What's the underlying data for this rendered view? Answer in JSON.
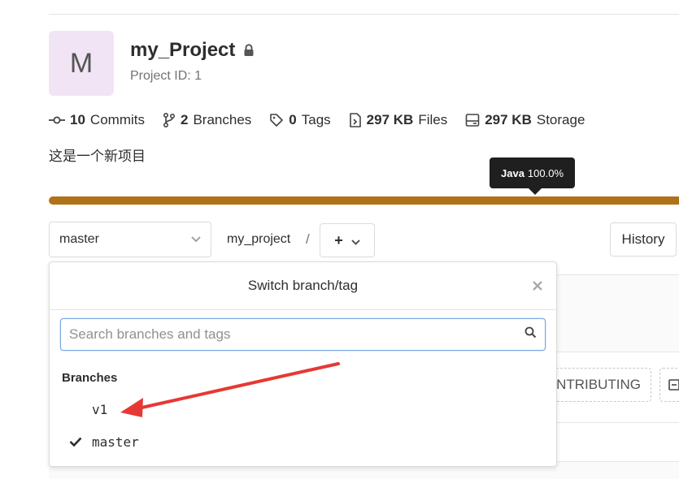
{
  "project": {
    "avatar_letter": "M",
    "name": "my_Project",
    "id_label": "Project ID: 1",
    "description": "这是一个新项目"
  },
  "stats": [
    {
      "icon": "commit-icon",
      "count": "10",
      "label": "Commits"
    },
    {
      "icon": "branch-icon",
      "count": "2",
      "label": "Branches"
    },
    {
      "icon": "tag-icon",
      "count": "0",
      "label": "Tags"
    },
    {
      "icon": "file-icon",
      "count": "297 KB",
      "label": "Files"
    },
    {
      "icon": "storage-icon",
      "count": "297 KB",
      "label": "Storage"
    }
  ],
  "languages": {
    "tooltip_name": "Java",
    "tooltip_percent": "100.0%",
    "bar_color": "#b07219",
    "java_share": 1.0
  },
  "toolbar": {
    "branch_selected": "master",
    "path": "my_project",
    "separator": "/",
    "add_symbol": "+",
    "history_label": "History"
  },
  "background": {
    "contributing_label": "CONTRIBUTING"
  },
  "dropdown": {
    "title": "Switch branch/tag",
    "search_placeholder": "Search branches and tags",
    "section_label": "Branches",
    "branches": [
      {
        "name": "v1",
        "selected": false
      },
      {
        "name": "master",
        "selected": true
      }
    ]
  },
  "annotation": {
    "arrow_color": "#e53935"
  }
}
